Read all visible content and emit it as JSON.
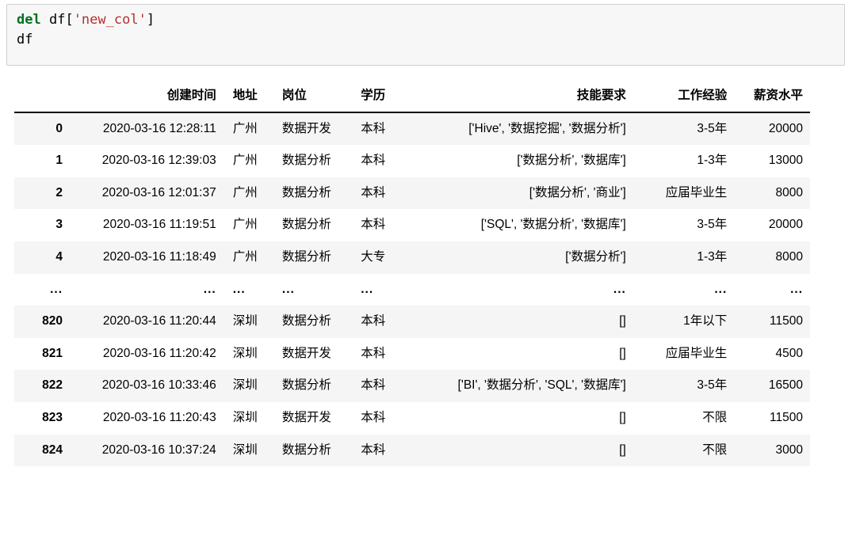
{
  "code_cell": {
    "lines": [
      [
        {
          "t": "del",
          "c": "kw"
        },
        {
          "t": " df",
          "c": "name"
        },
        {
          "t": "[",
          "c": "punc"
        },
        {
          "t": "'new_col'",
          "c": "str"
        },
        {
          "t": "]",
          "c": "punc"
        }
      ],
      [
        {
          "t": "df",
          "c": "name"
        }
      ]
    ],
    "raw": "del df['new_col']\ndf",
    "background": "#f7f7f7",
    "border_color": "#cfcfcf",
    "keyword_color": "#007020",
    "string_color": "#b5302e"
  },
  "dataframe": {
    "index_header": "",
    "columns": [
      {
        "key": "created_time",
        "label": "创建时间",
        "align": "right"
      },
      {
        "key": "city",
        "label": "地址",
        "align": "left"
      },
      {
        "key": "position",
        "label": "岗位",
        "align": "left"
      },
      {
        "key": "education",
        "label": "学历",
        "align": "left"
      },
      {
        "key": "skills",
        "label": "技能要求",
        "align": "right"
      },
      {
        "key": "experience",
        "label": "工作经验",
        "align": "right"
      },
      {
        "key": "salary",
        "label": "薪资水平",
        "align": "right"
      }
    ],
    "rows": [
      {
        "index": "0",
        "created_time": "2020-03-16 12:28:11",
        "city": "广州",
        "position": "数据开发",
        "education": "本科",
        "skills": "['Hive', '数据挖掘', '数据分析']",
        "experience": "3-5年",
        "salary": "20000"
      },
      {
        "index": "1",
        "created_time": "2020-03-16 12:39:03",
        "city": "广州",
        "position": "数据分析",
        "education": "本科",
        "skills": "['数据分析', '数据库']",
        "experience": "1-3年",
        "salary": "13000"
      },
      {
        "index": "2",
        "created_time": "2020-03-16 12:01:37",
        "city": "广州",
        "position": "数据分析",
        "education": "本科",
        "skills": "['数据分析', '商业']",
        "experience": "应届毕业生",
        "salary": "8000"
      },
      {
        "index": "3",
        "created_time": "2020-03-16 11:19:51",
        "city": "广州",
        "position": "数据分析",
        "education": "本科",
        "skills": "['SQL', '数据分析', '数据库']",
        "experience": "3-5年",
        "salary": "20000"
      },
      {
        "index": "4",
        "created_time": "2020-03-16 11:18:49",
        "city": "广州",
        "position": "数据分析",
        "education": "大专",
        "skills": "['数据分析']",
        "experience": "1-3年",
        "salary": "8000"
      },
      {
        "index": "...",
        "created_time": "...",
        "city": "...",
        "position": "...",
        "education": "...",
        "skills": "...",
        "experience": "...",
        "salary": "...",
        "is_ellipsis": true
      },
      {
        "index": "820",
        "created_time": "2020-03-16 11:20:44",
        "city": "深圳",
        "position": "数据分析",
        "education": "本科",
        "skills": "[]",
        "experience": "1年以下",
        "salary": "11500"
      },
      {
        "index": "821",
        "created_time": "2020-03-16 11:20:42",
        "city": "深圳",
        "position": "数据开发",
        "education": "本科",
        "skills": "[]",
        "experience": "应届毕业生",
        "salary": "4500"
      },
      {
        "index": "822",
        "created_time": "2020-03-16 10:33:46",
        "city": "深圳",
        "position": "数据分析",
        "education": "本科",
        "skills": "['BI', '数据分析', 'SQL', '数据库']",
        "experience": "3-5年",
        "salary": "16500"
      },
      {
        "index": "823",
        "created_time": "2020-03-16 11:20:43",
        "city": "深圳",
        "position": "数据开发",
        "education": "本科",
        "skills": "[]",
        "experience": "不限",
        "salary": "11500"
      },
      {
        "index": "824",
        "created_time": "2020-03-16 10:37:24",
        "city": "深圳",
        "position": "数据分析",
        "education": "本科",
        "skills": "[]",
        "experience": "不限",
        "salary": "3000"
      }
    ],
    "stripe_color": "#f5f5f5",
    "header_rule_color": "#000000"
  }
}
